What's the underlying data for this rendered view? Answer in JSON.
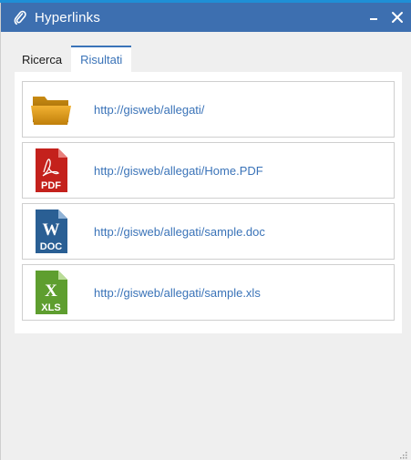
{
  "window": {
    "title": "Hyperlinks",
    "title_icon": "paperclip-icon",
    "minimize_icon": "minimize-icon",
    "close_icon": "close-icon",
    "titlebar_color": "#3d6fb0",
    "accent_color": "#3a73b8"
  },
  "tabs": [
    {
      "label": "Ricerca",
      "active": false
    },
    {
      "label": "Risultati",
      "active": true
    }
  ],
  "results": [
    {
      "icon": "folder-icon",
      "url": "http://gisweb/allegati/"
    },
    {
      "icon": "pdf-file-icon",
      "icon_label": "PDF",
      "url": "http://gisweb/allegati/Home.PDF"
    },
    {
      "icon": "doc-file-icon",
      "icon_label": "DOC",
      "icon_letter": "W",
      "url": "http://gisweb/allegati/sample.doc"
    },
    {
      "icon": "xls-file-icon",
      "icon_label": "XLS",
      "icon_letter": "X",
      "url": "http://gisweb/allegati/sample.xls"
    }
  ]
}
